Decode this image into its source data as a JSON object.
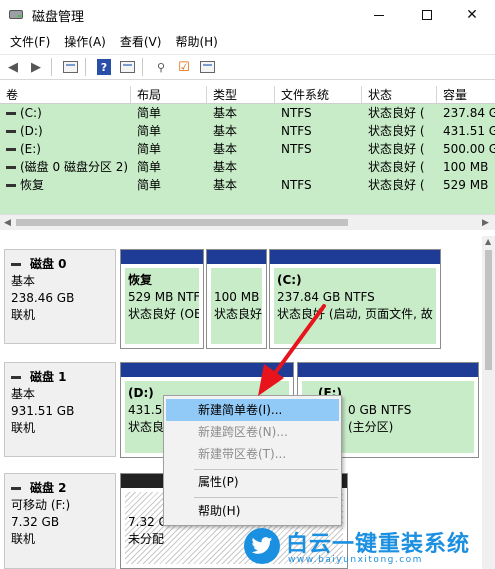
{
  "window": {
    "title": "磁盘管理",
    "icon": "disk-management-icon"
  },
  "menu": [
    "文件(F)",
    "操作(A)",
    "查看(V)",
    "帮助(H)"
  ],
  "volume_list": {
    "columns": [
      "卷",
      "布局",
      "类型",
      "文件系统",
      "状态",
      "容量"
    ],
    "rows": [
      {
        "name": "(C:)",
        "layout": "简单",
        "type": "基本",
        "fs": "NTFS",
        "status": "状态良好 (",
        "capacity": "237.84 G"
      },
      {
        "name": "(D:)",
        "layout": "简单",
        "type": "基本",
        "fs": "NTFS",
        "status": "状态良好 (",
        "capacity": "431.51 G"
      },
      {
        "name": "(E:)",
        "layout": "简单",
        "type": "基本",
        "fs": "NTFS",
        "status": "状态良好 (",
        "capacity": "500.00 G"
      },
      {
        "name": "(磁盘 0 磁盘分区 2)",
        "layout": "简单",
        "type": "基本",
        "fs": "",
        "status": "状态良好 (",
        "capacity": "100 MB"
      },
      {
        "name": "恢复",
        "layout": "简单",
        "type": "基本",
        "fs": "NTFS",
        "status": "状态良好 (",
        "capacity": "529 MB"
      }
    ]
  },
  "disks": [
    {
      "name": "磁盘 0",
      "type": "基本",
      "size": "238.46 GB",
      "state": "联机",
      "partitions": [
        {
          "title": "恢复",
          "size": "529 MB NTF",
          "status": "状态良好 (OE"
        },
        {
          "title": "",
          "size": "100 MB",
          "status": "状态良好"
        },
        {
          "title": "(C:)",
          "size": "237.84 GB NTFS",
          "status": "状态良好 (启动, 页面文件, 故"
        }
      ]
    },
    {
      "name": "磁盘 1",
      "type": "基本",
      "size": "931.51 GB",
      "state": "联机",
      "partitions": [
        {
          "title": "(D:)",
          "size": "431.51",
          "status": "状态良"
        },
        {
          "title": "(E:)",
          "size": "0 GB NTFS",
          "status": "(主分区)"
        }
      ]
    },
    {
      "name": "磁盘 2",
      "type": "可移动 (F:)",
      "size": "7.32 GB",
      "state": "联机",
      "partitions": [
        {
          "title": "",
          "size": "7.32 G",
          "status": "未分配"
        }
      ]
    }
  ],
  "context_menu": {
    "items": [
      {
        "label": "新建简单卷(I)...",
        "state": "active"
      },
      {
        "label": "新建跨区卷(N)...",
        "state": "disabled"
      },
      {
        "label": "新建带区卷(T)...",
        "state": "disabled"
      },
      {
        "label": "属性(P)",
        "state": "normal"
      },
      {
        "label": "帮助(H)",
        "state": "normal"
      }
    ]
  },
  "watermark": {
    "text": "白云一键重装系统",
    "url": "www.baiyunxitong.com",
    "icon": "twitter-bird-icon"
  },
  "colors": {
    "volume_bg": "#c8ebc8",
    "partition_bar": "#1e3c96",
    "menu_highlight": "#91c9f7",
    "arrow": "#e8141c",
    "watermark": "#1b8fe0"
  }
}
